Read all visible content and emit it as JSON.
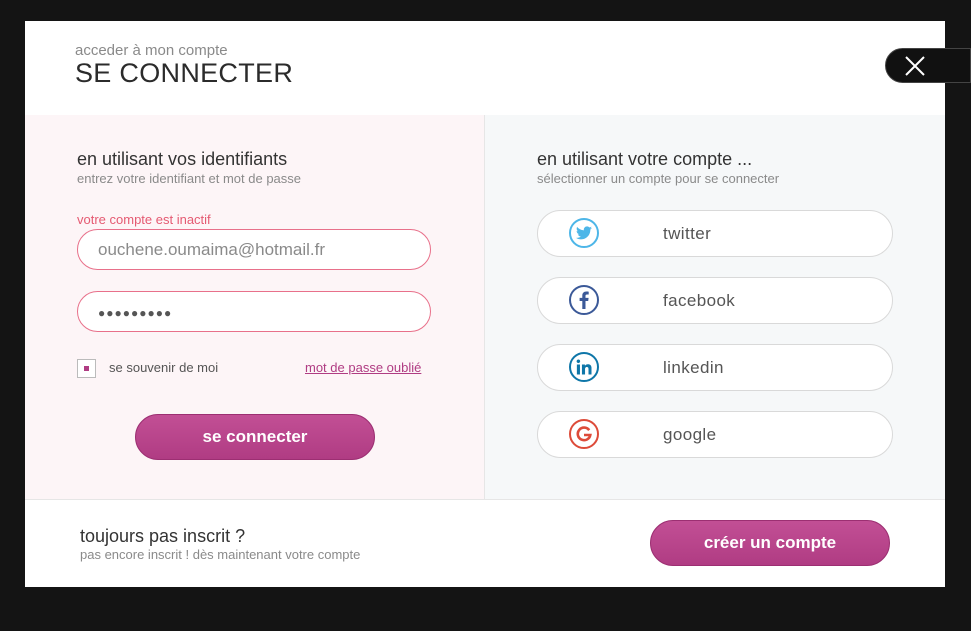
{
  "modal": {
    "subtitle": "acceder à mon compte",
    "title": "SE CONNECTER"
  },
  "credentials": {
    "title": "en utilisant vos identifiants",
    "subtitle": "entrez votre identifiant et mot de passe",
    "error": "votre compte est inactif",
    "email_value": "ouchene.oumaima@hotmail.fr",
    "password_mask": "●●●●●●●●●",
    "remember_label": "se souvenir de moi",
    "remember_checked": true,
    "forgot_label": "mot de passe oublié",
    "submit_label": "se connecter"
  },
  "social": {
    "title": "en utilisant votre compte ...",
    "subtitle": "sélectionner un compte pour se connecter",
    "providers": [
      {
        "label": "twitter",
        "icon": "twitter-icon",
        "color": "#4db6e8"
      },
      {
        "label": "facebook",
        "icon": "facebook-icon",
        "color": "#3b5998"
      },
      {
        "label": "linkedin",
        "icon": "linkedin-icon",
        "color": "#0e76a8"
      },
      {
        "label": "google",
        "icon": "google-icon",
        "color": "#dd4b39"
      }
    ]
  },
  "signup": {
    "title": "toujours pas inscrit ?",
    "subtitle": "pas encore inscrit ! dès maintenant votre compte",
    "button_label": "créer un compte"
  },
  "colors": {
    "accent": "#b03c83",
    "error": "#e55a72"
  }
}
